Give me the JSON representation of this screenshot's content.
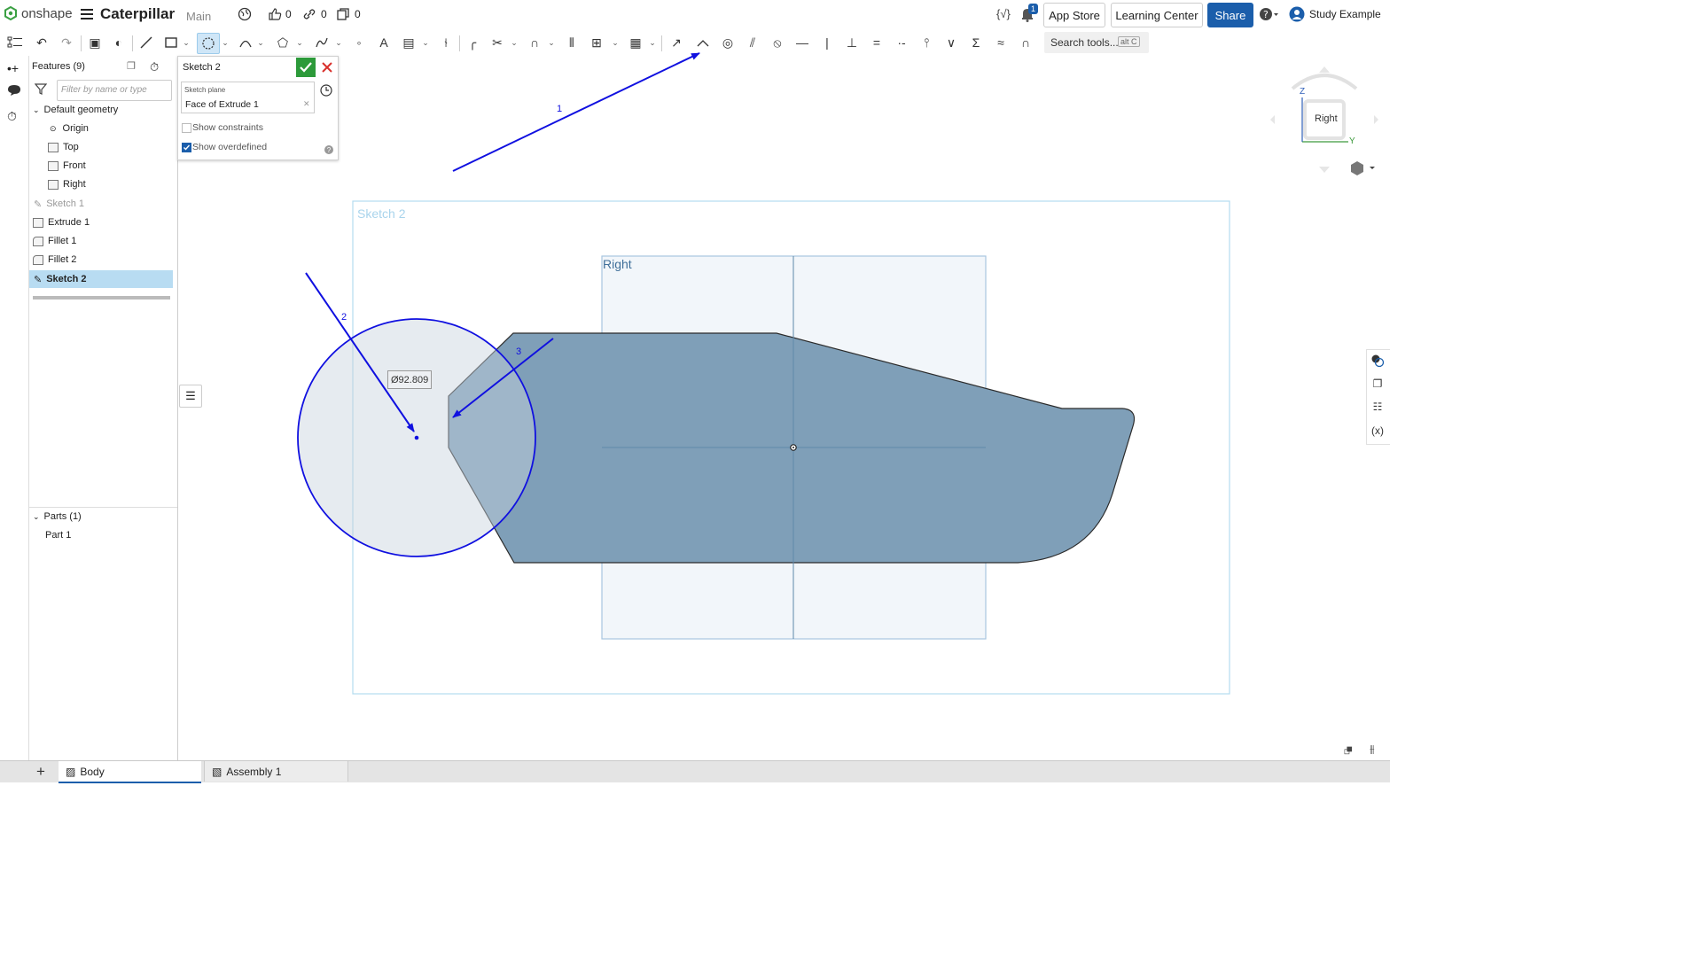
{
  "app": {
    "logo_text": "onshape",
    "document_title": "Caterpillar",
    "branch": "Main",
    "likes": "0",
    "links": "0",
    "copies": "0",
    "notification_count": "1",
    "app_store": "App Store",
    "learning_center": "Learning Center",
    "share": "Share",
    "user": "Study Example",
    "search_placeholder": "Search tools...",
    "search_shortcut": "alt C"
  },
  "features": {
    "header": "Features (9)",
    "filter_placeholder": "Filter by name or type",
    "default_geometry": "Default geometry",
    "items": [
      {
        "label": "Origin"
      },
      {
        "label": "Top"
      },
      {
        "label": "Front"
      },
      {
        "label": "Right"
      },
      {
        "label": "Sketch 1"
      },
      {
        "label": "Extrude 1"
      },
      {
        "label": "Fillet 1"
      },
      {
        "label": "Fillet 2"
      },
      {
        "label": "Sketch 2"
      }
    ],
    "parts_header": "Parts (1)",
    "part_item": "Part 1"
  },
  "dialog": {
    "title": "Sketch 2",
    "plane_label": "Sketch plane",
    "plane_value": "Face of Extrude 1",
    "show_constraints": "Show constraints",
    "show_overdefined": "Show overdefined",
    "show_overdefined_checked": true
  },
  "viewport": {
    "sketch_label": "Sketch 2",
    "plane_label": "Right",
    "dimension": "Ø92.809",
    "annotations": [
      "1",
      "2",
      "3"
    ],
    "view_cube_face": "Right",
    "axis_z": "Z",
    "axis_y": "Y"
  },
  "tabs": {
    "body": "Body",
    "assembly": "Assembly 1"
  },
  "colors": {
    "share_button": "#1b5eab",
    "confirm_green": "#2c9a3a",
    "cancel_red": "#d9302c",
    "annotation_blue": "#1010e0",
    "part_fill": "#7f9fb8",
    "selected_row": "#b8dcf2"
  }
}
